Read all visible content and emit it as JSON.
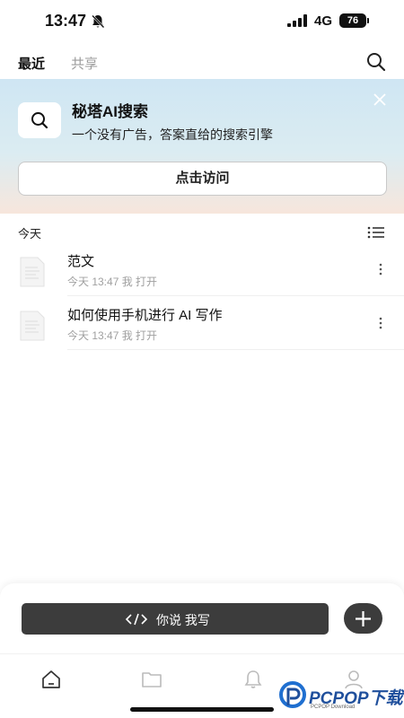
{
  "status_bar": {
    "time": "13:47",
    "network": "4G",
    "battery": "76",
    "icons": [
      "bell-off-icon",
      "signal-icon",
      "battery-icon"
    ]
  },
  "header": {
    "tabs": [
      {
        "label": "最近",
        "active": true
      },
      {
        "label": "共享",
        "active": false
      }
    ],
    "search_icon": "search-icon"
  },
  "banner": {
    "title": "秘塔AI搜索",
    "subtitle": "一个没有广告，答案直给的搜索引擎",
    "button_label": "点击访问",
    "icons": [
      "search-icon",
      "close-icon"
    ]
  },
  "section": {
    "label": "今天",
    "toggle_icon": "list-view-icon"
  },
  "documents": [
    {
      "title": "范文",
      "meta": "今天 13:47 我 打开"
    },
    {
      "title": "如何使用手机进行 AI 写作",
      "meta": "今天 13:47 我 打开"
    }
  ],
  "composer": {
    "write_label": "你说 我写",
    "icons": [
      "code-icon",
      "plus-icon"
    ]
  },
  "tabbar": {
    "items": [
      "home-icon",
      "folder-icon",
      "bell-icon",
      "user-icon"
    ]
  },
  "watermark": {
    "brand": "PCPOP下载",
    "sub": "PCPOP Download"
  },
  "colors": {
    "dark_button": "#3c3c3c",
    "banner_top": "#cfe6f3",
    "banner_bottom": "#f7e6dc",
    "muted_text": "#a0a0a0",
    "watermark_blue": "#1f4f9c"
  }
}
